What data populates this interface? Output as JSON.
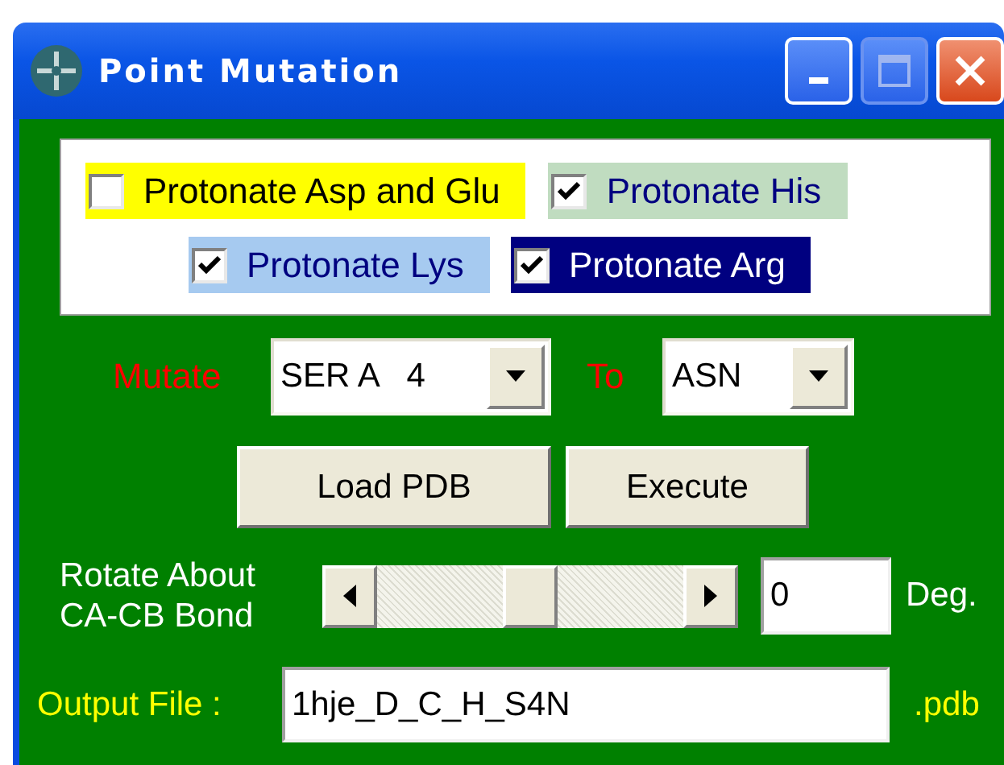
{
  "window": {
    "title": "Point Mutation"
  },
  "protonation": [
    {
      "label": "Protonate Asp and Glu",
      "checked": false,
      "color": "#ffff00"
    },
    {
      "label": "Protonate His",
      "checked": true,
      "color": "#c0dcc0"
    },
    {
      "label": "Protonate Lys",
      "checked": true,
      "color": "#a6caf0"
    },
    {
      "label": "Protonate Arg",
      "checked": true,
      "color": "#000080"
    }
  ],
  "mutate": {
    "label": "Mutate",
    "residue": "SER A   4",
    "to_label": "To",
    "target": "ASN"
  },
  "buttons": [
    "Load PDB",
    "Execute"
  ],
  "rotation": {
    "label": "Rotate About CA-CB Bond",
    "level": 0.5,
    "value": "0",
    "unit": "Deg."
  },
  "output": {
    "label": "Output File :",
    "value": "1hje_D_C_H_S4N",
    "extension": ".pdb"
  }
}
